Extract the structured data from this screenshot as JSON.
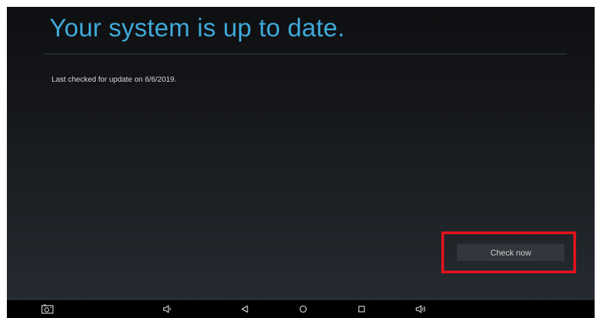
{
  "header": {
    "title": "Your system is up to date."
  },
  "status": {
    "last_checked": "Last checked for update on 6/6/2019."
  },
  "actions": {
    "check_now_label": "Check now"
  },
  "nav_bar": {
    "icons": [
      "screenshot-icon",
      "volume-down-icon",
      "back-icon",
      "home-icon",
      "recents-icon",
      "volume-up-icon"
    ]
  },
  "colors": {
    "accent": "#3fa9d8",
    "highlight": "#e0141c",
    "button_bg": "#32373d"
  }
}
